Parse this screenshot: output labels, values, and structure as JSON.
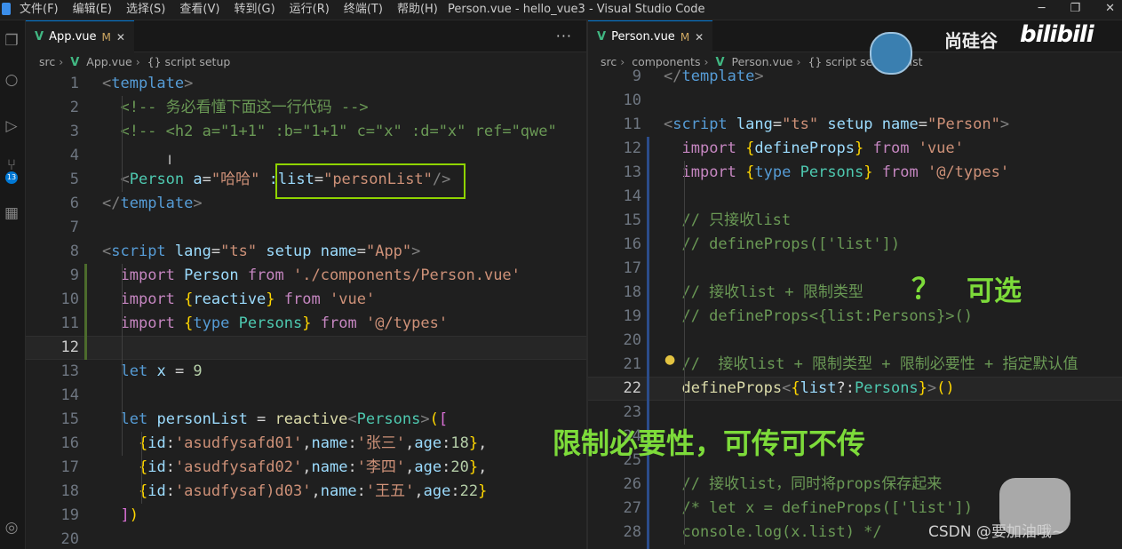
{
  "titlebar": {
    "menu": [
      "文件(F)",
      "编辑(E)",
      "选择(S)",
      "查看(V)",
      "转到(G)",
      "运行(R)",
      "终端(T)",
      "帮助(H)"
    ],
    "title": "Person.vue - hello_vue3 - Visual Studio Code"
  },
  "left": {
    "tab_label": "App.vue",
    "tab_modified": "M",
    "breadcrumb": [
      "src",
      "App.vue",
      "{} script setup"
    ],
    "lines": [
      {
        "n": "1",
        "segments": [
          [
            "tok-punct",
            "<"
          ],
          [
            "tok-tag",
            "template"
          ],
          [
            "tok-punct",
            ">"
          ]
        ]
      },
      {
        "n": "2",
        "segments": [
          [
            "tok-comment",
            "  <!-- 务必看懂下面这一行代码 -->"
          ]
        ]
      },
      {
        "n": "3",
        "segments": [
          [
            "tok-comment",
            "  <!-- <h2 a=\"1+1\" :b=\"1+1\" c=\"x\" :d=\"x\" ref=\"qwe\""
          ]
        ]
      },
      {
        "n": "4",
        "segments": []
      },
      {
        "n": "5",
        "segments": [
          [
            "tok-plain",
            "  "
          ],
          [
            "tok-punct",
            "<"
          ],
          [
            "tok-type",
            "Person"
          ],
          [
            "tok-plain",
            " "
          ],
          [
            "tok-attr",
            "a"
          ],
          [
            "tok-plain",
            "="
          ],
          [
            "tok-str",
            "\"哈哈\""
          ],
          [
            "tok-plain",
            " "
          ],
          [
            "tok-attr",
            ":list"
          ],
          [
            "tok-plain",
            "="
          ],
          [
            "tok-str",
            "\"personList\""
          ],
          [
            "tok-punct",
            "/>"
          ]
        ]
      },
      {
        "n": "6",
        "segments": [
          [
            "tok-punct",
            "</"
          ],
          [
            "tok-tag",
            "template"
          ],
          [
            "tok-punct",
            ">"
          ]
        ]
      },
      {
        "n": "7",
        "segments": []
      },
      {
        "n": "8",
        "segments": [
          [
            "tok-punct",
            "<"
          ],
          [
            "tok-tag",
            "script"
          ],
          [
            "tok-plain",
            " "
          ],
          [
            "tok-attr",
            "lang"
          ],
          [
            "tok-plain",
            "="
          ],
          [
            "tok-str",
            "\"ts\""
          ],
          [
            "tok-plain",
            " "
          ],
          [
            "tok-attr",
            "setup"
          ],
          [
            "tok-plain",
            " "
          ],
          [
            "tok-attr",
            "name"
          ],
          [
            "tok-plain",
            "="
          ],
          [
            "tok-str",
            "\"App\""
          ],
          [
            "tok-punct",
            ">"
          ]
        ]
      },
      {
        "n": "9",
        "segments": [
          [
            "tok-plain",
            "  "
          ],
          [
            "tok-kw",
            "import"
          ],
          [
            "tok-plain",
            " "
          ],
          [
            "tok-var",
            "Person"
          ],
          [
            "tok-plain",
            " "
          ],
          [
            "tok-kw",
            "from"
          ],
          [
            "tok-plain",
            " "
          ],
          [
            "tok-str",
            "'./components/Person.vue'"
          ]
        ]
      },
      {
        "n": "10",
        "segments": [
          [
            "tok-plain",
            "  "
          ],
          [
            "tok-kw",
            "import"
          ],
          [
            "tok-plain",
            " "
          ],
          [
            "tok-brace",
            "{"
          ],
          [
            "tok-var",
            "reactive"
          ],
          [
            "tok-brace",
            "}"
          ],
          [
            "tok-plain",
            " "
          ],
          [
            "tok-kw",
            "from"
          ],
          [
            "tok-plain",
            " "
          ],
          [
            "tok-str",
            "'vue'"
          ]
        ]
      },
      {
        "n": "11",
        "segments": [
          [
            "tok-plain",
            "  "
          ],
          [
            "tok-kw",
            "import"
          ],
          [
            "tok-plain",
            " "
          ],
          [
            "tok-brace",
            "{"
          ],
          [
            "tok-decl",
            "type"
          ],
          [
            "tok-plain",
            " "
          ],
          [
            "tok-type",
            "Persons"
          ],
          [
            "tok-brace",
            "}"
          ],
          [
            "tok-plain",
            " "
          ],
          [
            "tok-kw",
            "from"
          ],
          [
            "tok-plain",
            " "
          ],
          [
            "tok-str",
            "'@/types'"
          ]
        ]
      },
      {
        "n": "12",
        "segments": []
      },
      {
        "n": "13",
        "segments": [
          [
            "tok-plain",
            "  "
          ],
          [
            "tok-decl",
            "let"
          ],
          [
            "tok-plain",
            " "
          ],
          [
            "tok-var",
            "x"
          ],
          [
            "tok-plain",
            " = "
          ],
          [
            "tok-num",
            "9"
          ]
        ]
      },
      {
        "n": "14",
        "segments": []
      },
      {
        "n": "15",
        "segments": [
          [
            "tok-plain",
            "  "
          ],
          [
            "tok-decl",
            "let"
          ],
          [
            "tok-plain",
            " "
          ],
          [
            "tok-var",
            "personList"
          ],
          [
            "tok-plain",
            " = "
          ],
          [
            "tok-fn",
            "reactive"
          ],
          [
            "tok-punct",
            "<"
          ],
          [
            "tok-type",
            "Persons"
          ],
          [
            "tok-punct",
            ">"
          ],
          [
            "tok-brace",
            "("
          ],
          [
            "tok-bracket",
            "["
          ]
        ]
      },
      {
        "n": "16",
        "segments": [
          [
            "tok-plain",
            "    "
          ],
          [
            "tok-brace",
            "{"
          ],
          [
            "tok-var",
            "id"
          ],
          [
            "tok-plain",
            ":"
          ],
          [
            "tok-str",
            "'asudfysafd01'"
          ],
          [
            "tok-plain",
            ","
          ],
          [
            "tok-var",
            "name"
          ],
          [
            "tok-plain",
            ":"
          ],
          [
            "tok-str",
            "'张三'"
          ],
          [
            "tok-plain",
            ","
          ],
          [
            "tok-var",
            "age"
          ],
          [
            "tok-plain",
            ":"
          ],
          [
            "tok-num",
            "18"
          ],
          [
            "tok-brace",
            "}"
          ],
          [
            "tok-plain",
            ","
          ]
        ]
      },
      {
        "n": "17",
        "segments": [
          [
            "tok-plain",
            "    "
          ],
          [
            "tok-brace",
            "{"
          ],
          [
            "tok-var",
            "id"
          ],
          [
            "tok-plain",
            ":"
          ],
          [
            "tok-str",
            "'asudfysafd02'"
          ],
          [
            "tok-plain",
            ","
          ],
          [
            "tok-var",
            "name"
          ],
          [
            "tok-plain",
            ":"
          ],
          [
            "tok-str",
            "'李四'"
          ],
          [
            "tok-plain",
            ","
          ],
          [
            "tok-var",
            "age"
          ],
          [
            "tok-plain",
            ":"
          ],
          [
            "tok-num",
            "20"
          ],
          [
            "tok-brace",
            "}"
          ],
          [
            "tok-plain",
            ","
          ]
        ]
      },
      {
        "n": "18",
        "segments": [
          [
            "tok-plain",
            "    "
          ],
          [
            "tok-brace",
            "{"
          ],
          [
            "tok-var",
            "id"
          ],
          [
            "tok-plain",
            ":"
          ],
          [
            "tok-str",
            "'asudfysaf)d03'"
          ],
          [
            "tok-plain",
            ","
          ],
          [
            "tok-var",
            "name"
          ],
          [
            "tok-plain",
            ":"
          ],
          [
            "tok-str",
            "'王五'"
          ],
          [
            "tok-plain",
            ","
          ],
          [
            "tok-var",
            "age"
          ],
          [
            "tok-plain",
            ":"
          ],
          [
            "tok-num",
            "22"
          ],
          [
            "tok-brace",
            "}"
          ]
        ]
      },
      {
        "n": "19",
        "segments": [
          [
            "tok-plain",
            "  "
          ],
          [
            "tok-bracket",
            "]"
          ],
          [
            "tok-brace",
            ")"
          ]
        ]
      },
      {
        "n": "20",
        "segments": []
      }
    ]
  },
  "right": {
    "tab_label": "Person.vue",
    "tab_modified": "M",
    "breadcrumb": [
      "src",
      "components",
      "Person.vue",
      "{} script setup",
      "list"
    ],
    "lines": [
      {
        "n": "9",
        "segments": [
          [
            "tok-punct",
            "</"
          ],
          [
            "tok-tag",
            "template"
          ],
          [
            "tok-punct",
            ">"
          ]
        ]
      },
      {
        "n": "10",
        "segments": []
      },
      {
        "n": "11",
        "segments": [
          [
            "tok-punct",
            "<"
          ],
          [
            "tok-tag",
            "script"
          ],
          [
            "tok-plain",
            " "
          ],
          [
            "tok-attr",
            "lang"
          ],
          [
            "tok-plain",
            "="
          ],
          [
            "tok-str",
            "\"ts\""
          ],
          [
            "tok-plain",
            " "
          ],
          [
            "tok-attr",
            "setup"
          ],
          [
            "tok-plain",
            " "
          ],
          [
            "tok-attr",
            "name"
          ],
          [
            "tok-plain",
            "="
          ],
          [
            "tok-str",
            "\"Person\""
          ],
          [
            "tok-punct",
            ">"
          ]
        ]
      },
      {
        "n": "12",
        "segments": [
          [
            "tok-plain",
            "  "
          ],
          [
            "tok-kw",
            "import"
          ],
          [
            "tok-plain",
            " "
          ],
          [
            "tok-brace",
            "{"
          ],
          [
            "tok-var",
            "defineProps"
          ],
          [
            "tok-brace",
            "}"
          ],
          [
            "tok-plain",
            " "
          ],
          [
            "tok-kw",
            "from"
          ],
          [
            "tok-plain",
            " "
          ],
          [
            "tok-str",
            "'vue'"
          ]
        ]
      },
      {
        "n": "13",
        "segments": [
          [
            "tok-plain",
            "  "
          ],
          [
            "tok-kw",
            "import"
          ],
          [
            "tok-plain",
            " "
          ],
          [
            "tok-brace",
            "{"
          ],
          [
            "tok-decl",
            "type"
          ],
          [
            "tok-plain",
            " "
          ],
          [
            "tok-type",
            "Persons"
          ],
          [
            "tok-brace",
            "}"
          ],
          [
            "tok-plain",
            " "
          ],
          [
            "tok-kw",
            "from"
          ],
          [
            "tok-plain",
            " "
          ],
          [
            "tok-str",
            "'@/types'"
          ]
        ]
      },
      {
        "n": "14",
        "segments": []
      },
      {
        "n": "15",
        "segments": [
          [
            "tok-comment",
            "  // 只接收list"
          ]
        ]
      },
      {
        "n": "16",
        "segments": [
          [
            "tok-comment",
            "  // defineProps(['list'])"
          ]
        ]
      },
      {
        "n": "17",
        "segments": []
      },
      {
        "n": "18",
        "segments": [
          [
            "tok-comment",
            "  // 接收list + 限制类型"
          ]
        ]
      },
      {
        "n": "19",
        "segments": [
          [
            "tok-comment",
            "  // defineProps<{list:Persons}>()"
          ]
        ]
      },
      {
        "n": "20",
        "segments": []
      },
      {
        "n": "21",
        "segments": [
          [
            "tok-comment",
            "  //  接收list + 限制类型 + 限制必要性 + 指定默认值"
          ]
        ]
      },
      {
        "n": "22",
        "segments": [
          [
            "tok-plain",
            "  "
          ],
          [
            "tok-fn",
            "defineProps"
          ],
          [
            "tok-punct",
            "<"
          ],
          [
            "tok-brace",
            "{"
          ],
          [
            "tok-var",
            "list"
          ],
          [
            "tok-plain",
            "?:"
          ],
          [
            "tok-type",
            "Persons"
          ],
          [
            "tok-brace",
            "}"
          ],
          [
            "tok-punct",
            ">"
          ],
          [
            "tok-brace",
            "()"
          ]
        ]
      },
      {
        "n": "23",
        "segments": []
      },
      {
        "n": "24",
        "segments": []
      },
      {
        "n": "25",
        "segments": []
      },
      {
        "n": "26",
        "segments": [
          [
            "tok-comment",
            "  // 接收list，同时将props保存起来"
          ]
        ]
      },
      {
        "n": "27",
        "segments": [
          [
            "tok-comment",
            "  /* let x = defineProps(['list'])"
          ]
        ]
      },
      {
        "n": "28",
        "segments": [
          [
            "tok-comment",
            "  console.log(x.list) */"
          ]
        ]
      }
    ]
  },
  "overlays": {
    "question_mark": "？",
    "optional": "可选",
    "annotation": "限制必要性，可传可不传",
    "brand_cn": "尚硅谷",
    "brand_bili": "bilibili",
    "watermark": "CSDN @要加油哦~"
  },
  "icons": {
    "activity": [
      "files-icon",
      "search-icon",
      "run-debug-icon",
      "source-control-icon",
      "extensions-icon",
      "account-icon"
    ]
  },
  "colors": {
    "highlight_box": "#8fd400",
    "annotation_text": "#7ddb3a",
    "accent": "#0078d4"
  }
}
